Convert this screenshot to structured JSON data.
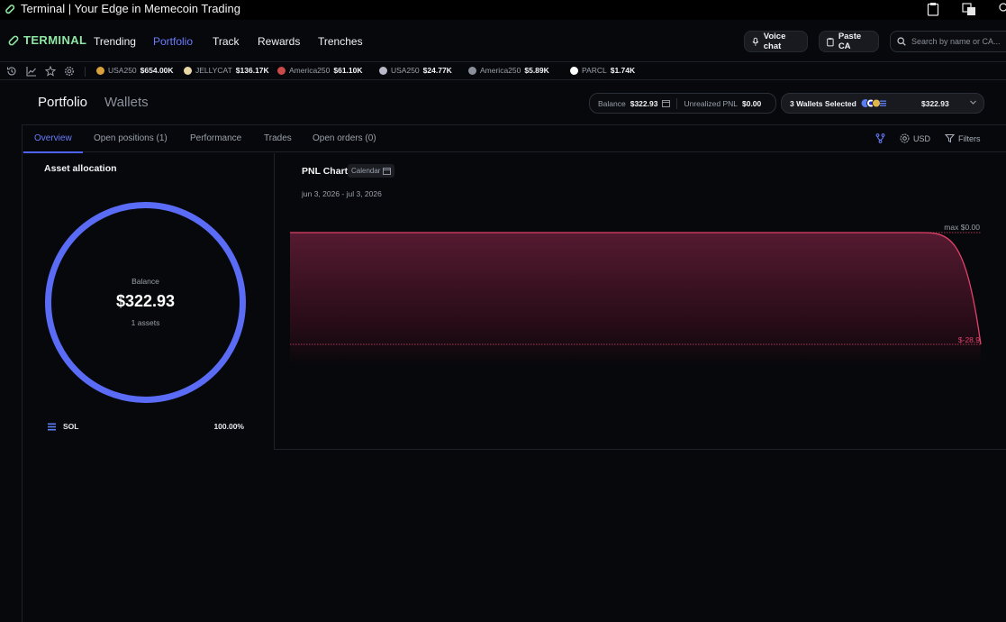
{
  "window": {
    "title": "Terminal | Your Edge in Memecoin Trading"
  },
  "nav": {
    "logo": "TERMINAL",
    "links": [
      "Trending",
      "Portfolio",
      "Track",
      "Rewards",
      "Trenches"
    ],
    "active": "Portfolio",
    "voice_chat": "Voice chat",
    "paste_ca": "Paste CA",
    "search_placeholder": "Search by name or CA..."
  },
  "ticker": [
    {
      "name": "USA250",
      "value": "$654.00K",
      "color": "#d8a23a"
    },
    {
      "name": "JELLYCAT",
      "value": "$136.17K",
      "color": "#e9d8a6"
    },
    {
      "name": "America250",
      "value": "$61.10K",
      "color": "#c84a4a"
    },
    {
      "name": "USA250",
      "value": "$24.77K",
      "color": "#b8b8c8"
    },
    {
      "name": "America250",
      "value": "$5.89K",
      "color": "#8a8f9b"
    },
    {
      "name": "PARCL",
      "value": "$1.74K",
      "color": "#ffffff"
    }
  ],
  "header": {
    "title": "Portfolio",
    "title2": "Wallets",
    "balance_label": "Balance",
    "balance_value": "$322.93",
    "unrealized_label": "Unrealized PNL",
    "unrealized_value": "$0.00",
    "wallets_label": "3 Wallets Selected",
    "wallets_value": "$322.93"
  },
  "tabs": {
    "items": [
      "Overview",
      "Open positions (1)",
      "Performance",
      "Trades",
      "Open orders (0)"
    ],
    "active": "Overview",
    "currency": "USD",
    "filters": "Filters"
  },
  "allocation": {
    "title": "Asset allocation",
    "center_label": "Balance",
    "center_value": "$322.93",
    "center_sub": "1 assets",
    "ring_color": "#5a6cf5",
    "items": [
      {
        "name": "SOL",
        "pct": "100.00%"
      }
    ]
  },
  "pnl": {
    "title": "PNL Chart",
    "calendar_label": "Calendar",
    "date_range": "jun 3, 2026 - jul 3, 2026",
    "max_label": "max $0.00",
    "min_label": "$-28.9",
    "line_color": "#e0416a"
  },
  "chart_data": {
    "type": "area",
    "title": "PNL Chart",
    "xlabel": "",
    "ylabel": "",
    "x": [
      "jun 3, 2026",
      "jul 3, 2026"
    ],
    "series": [
      {
        "values": [
          0,
          0,
          0,
          0,
          0,
          0,
          0,
          0,
          0,
          0,
          0,
          -28.9
        ]
      }
    ],
    "ylim": [
      -28.9,
      0
    ],
    "grid": false
  }
}
